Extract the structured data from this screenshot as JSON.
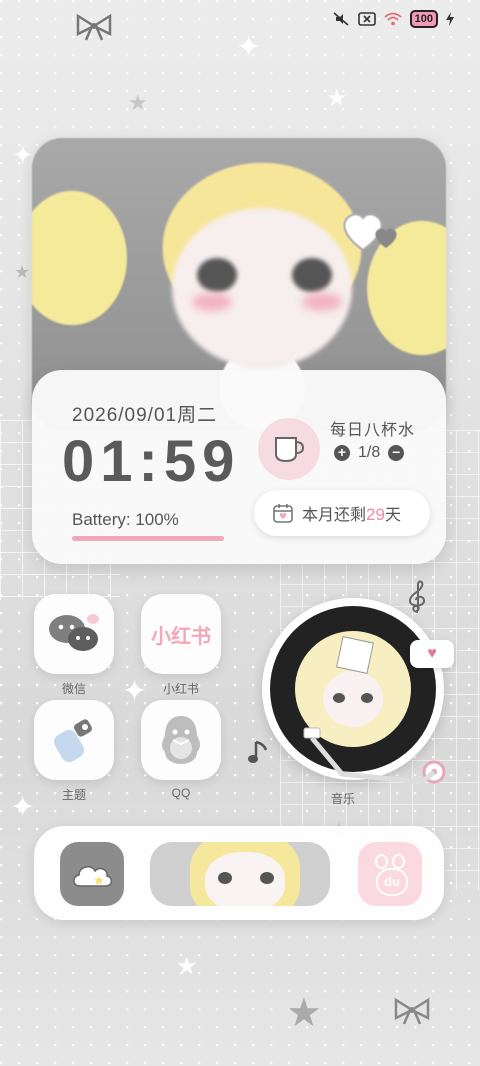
{
  "status_bar": {
    "battery": "100",
    "icons": [
      "mute-icon",
      "no-sim-icon",
      "wifi-icon",
      "battery-icon",
      "charging-icon"
    ]
  },
  "clock_widget": {
    "date": "2026/09/01周二",
    "time": "01:59",
    "battery_label": "Battery: 100%",
    "battery_level": 1.0,
    "water_title": "每日八杯水",
    "water_count": "1/8",
    "days_prefix": "本月还剩",
    "days_value": "29",
    "days_suffix": "天"
  },
  "apps": [
    {
      "label": "微信",
      "icon": "wechat-icon"
    },
    {
      "label": "小红书",
      "icon": "xiaohongshu-icon",
      "logo_text": "小红书"
    },
    {
      "label": "主题",
      "icon": "theme-icon"
    },
    {
      "label": "QQ",
      "icon": "qq-icon"
    }
  ],
  "music": {
    "label": "音乐"
  },
  "dock": {
    "items": [
      {
        "name": "weather-icon"
      },
      {
        "name": "avatar-widget"
      },
      {
        "name": "baidu-icon",
        "logo_text": "du"
      }
    ]
  },
  "colors": {
    "accent_pink": "#f089a6",
    "text_gray": "#555555"
  }
}
